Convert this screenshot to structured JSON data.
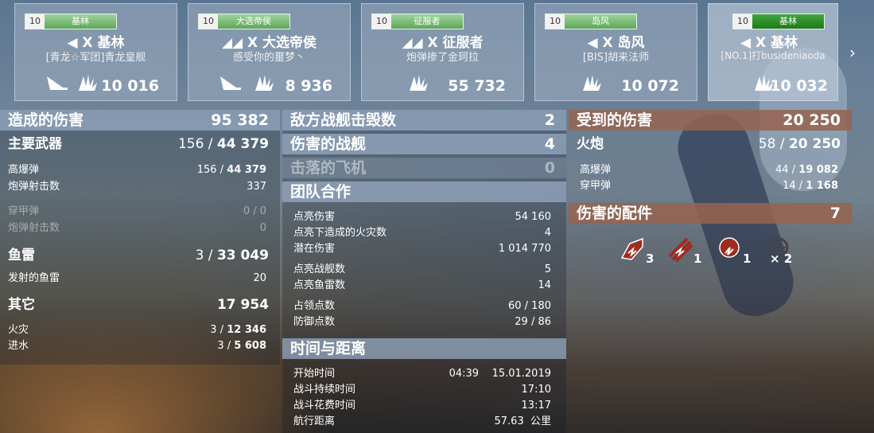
{
  "ships": [
    {
      "level": "10",
      "class": "基林",
      "name": "X 基林",
      "player": "[青龙☆军团]青龙皇舰",
      "score": "10 016",
      "has_plane": true
    },
    {
      "level": "10",
      "class": "大选帝侯",
      "name": "X 大选帝侯",
      "player": "感受你的噩梦丶",
      "score": "8 936",
      "has_plane": true
    },
    {
      "level": "10",
      "class": "征服者",
      "name": "X 征服者",
      "player": "炮弹掺了金珂拉",
      "score": "55 732",
      "has_plane": false
    },
    {
      "level": "10",
      "class": "岛风",
      "name": "X 岛风",
      "player": "[BIS]胡来法师",
      "score": "10 072",
      "has_plane": false
    },
    {
      "level": "10",
      "class": "基林",
      "name": "X 基林",
      "player": "[NO.1]打busideniaoda",
      "score": "10 032",
      "has_plane": false
    }
  ],
  "damage_dealt": {
    "title": "造成的伤害",
    "total": "95 382",
    "main_battery": {
      "label": "主要武器",
      "a": "156",
      "b": "44 379"
    },
    "he": {
      "label": "高爆弹",
      "a": "156",
      "b": "44 379"
    },
    "shell_hits": {
      "label": "炮弹射击数",
      "v": "337"
    },
    "ap": {
      "label": "穿甲弹",
      "v": "0 / 0"
    },
    "ap_hits": {
      "label": "炮弹射击数",
      "v": "0"
    },
    "torpedo": {
      "label": "鱼雷",
      "a": "3",
      "b": "33 049"
    },
    "torps_fired": {
      "label": "发射的鱼雷",
      "v": "20"
    },
    "other": {
      "label": "其它",
      "v": "17 954"
    },
    "fire": {
      "label": "火灾",
      "a": "3",
      "b": "12 346"
    },
    "flood": {
      "label": "进水",
      "a": "3",
      "b": "5 608"
    }
  },
  "kills": {
    "ships_destroyed": {
      "label": "敌方战舰击毁数",
      "v": "2"
    },
    "ships_damaged": {
      "label": "伤害的战舰",
      "v": "4"
    },
    "planes_shot": {
      "label": "击落的飞机",
      "v": "0"
    }
  },
  "team": {
    "title": "团队合作",
    "rows": [
      {
        "label": "点亮伤害",
        "v": "54 160"
      },
      {
        "label": "点亮下造成的火灾数",
        "v": "4"
      },
      {
        "label": "潜在伤害",
        "v": "1 014 770"
      },
      {
        "label": "点亮战舰数",
        "v": "5"
      },
      {
        "label": "点亮鱼雷数",
        "v": "14"
      },
      {
        "label": "占领点数",
        "v": "60 / 180"
      },
      {
        "label": "防御点数",
        "v": "29 / 86"
      }
    ]
  },
  "time": {
    "title": "时间与距离",
    "start": {
      "label": "开始时间",
      "time": "04:39",
      "date": "15.01.2019"
    },
    "duration": {
      "label": "战斗持续时间",
      "v": "17:10"
    },
    "spent": {
      "label": "战斗花费时间",
      "v": "13:17"
    },
    "distance": {
      "label": "航行距离",
      "v": "57.63",
      "unit": "公里"
    }
  },
  "received": {
    "title": "受到的伤害",
    "total": "20 250",
    "guns": {
      "label": "火炮",
      "a": "58",
      "b": "20 250"
    },
    "he": {
      "label": "高爆弹",
      "a": "44",
      "b": "19 082"
    },
    "ap": {
      "label": "穿甲弹",
      "a": "14",
      "b": "1 168"
    }
  },
  "modules": {
    "title": "伤害的配件",
    "total": "7",
    "items": [
      {
        "icon": "turret-damaged-icon",
        "count": "3"
      },
      {
        "icon": "torpedo-tube-damaged-icon",
        "count": "1"
      },
      {
        "icon": "engine-damaged-icon",
        "count": "1"
      },
      {
        "icon": "steering-destroyed-icon",
        "count": "× 2"
      }
    ]
  },
  "colors": {
    "accent_green": "#5fa65a",
    "received_header": "#96644f"
  }
}
